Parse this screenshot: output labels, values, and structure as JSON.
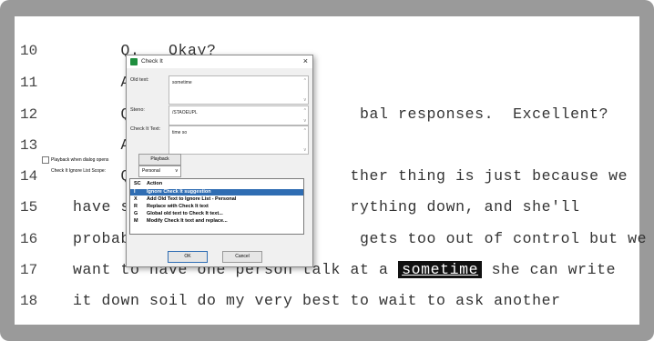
{
  "transcript": {
    "lines": [
      {
        "num": "10",
        "text": "     Q.   Okay?"
      },
      {
        "num": "11",
        "text": "     A"
      },
      {
        "num": "12",
        "text": "     Q                        bal responses.  Excellent?"
      },
      {
        "num": "13",
        "text": "     A"
      },
      {
        "num": "14",
        "text": "     Q                       ther thing is just because we"
      },
      {
        "num": "15",
        "text": "have s                       rything down, and she'll"
      },
      {
        "num": "16",
        "text": "probab                        gets too out of control but we"
      },
      {
        "num": "17",
        "pre": "want to have one person talk at a ",
        "hl": "sometime",
        "post": " she can write"
      },
      {
        "num": "18",
        "text": "it down soil do my very best to wait to ask another"
      }
    ]
  },
  "dialog": {
    "title": "Check It",
    "close": "×",
    "old_text_label": "Old text:",
    "old_text_value": "sometime",
    "steno_label": "Steno:",
    "steno_value": "/STAOEUPL",
    "check_text_label": "Check It Text:",
    "check_text_value": "time so",
    "playback_checkbox_label": "Playback when dialog opens",
    "playback_button": "Playback",
    "scope_label": "Check It Ignore List Scope:",
    "scope_value": "Personal",
    "scope_arrow": "v",
    "ok_button": "OK",
    "cancel_button": "Cancel"
  },
  "menu": {
    "header_sc": "SC",
    "header_action": "Action",
    "items": [
      {
        "key": "I",
        "action": "Ignore Check It suggestion"
      },
      {
        "key": "X",
        "action": "Add Old Text to Ignore List - Personal"
      },
      {
        "key": "R",
        "action": "Replace with Check It text"
      },
      {
        "key": "G",
        "action": "Global old text to Check It text..."
      },
      {
        "key": "M",
        "action": "Modify Check It text and replace..."
      }
    ]
  },
  "colors": {
    "menu_selected": "#2f6db3",
    "highlight_bg": "#111111",
    "title_icon": "#1e8e3e"
  }
}
